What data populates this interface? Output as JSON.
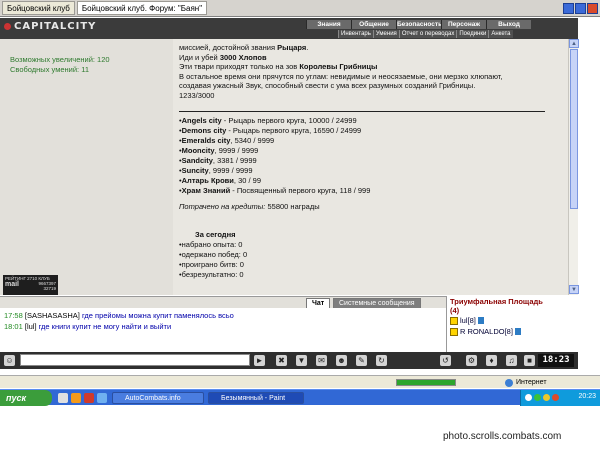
{
  "browser": {
    "tabs": [
      "Бойцовский клуб",
      "Бойцовский клуб. Форум: \"Баян\""
    ]
  },
  "header": {
    "logo": "CAPITALCITY",
    "nav_top": [
      "Знания",
      "Общение",
      "Безопасность",
      "Персонаж",
      "Выход"
    ],
    "nav_sub": [
      "Инвентарь",
      "Умения",
      "Отчет о переводах",
      "Поединки",
      "Анкета"
    ]
  },
  "left_panel": {
    "increases": "Возможных увеличений: 120",
    "skills": "Свободных умений: 11",
    "rating_label": "РЕЙТИНГ 2710 КЛУБ",
    "rating_values": [
      "9667397",
      "32719"
    ],
    "rating_brand": "mail"
  },
  "main": {
    "intro": [
      "миссией, достойной звания ",
      "Рыцаря",
      "Иди и убей ",
      "3000 Хлопов",
      "Эти твари приходят только на зов ",
      "Королевы Грибницы",
      "В остальное время они прячутся по углам: невидимые и неосязаемые, они мерзко хлюпают,",
      "создавая ужасный Звук, способный свести с ума всех разумных созданий Грибницы.",
      "1233/3000"
    ],
    "cities": [
      {
        "name": "Angels city",
        "desc": " - Рыцарь первого круга, 10000 / 24999"
      },
      {
        "name": "Demons city",
        "desc": " - Рыцарь первого круга, 16590 / 24999"
      },
      {
        "name": "Emeralds city",
        "desc": ", 5340 / 9999"
      },
      {
        "name": "Mooncity",
        "desc": ", 9999 / 9999"
      },
      {
        "name": "Sandcity",
        "desc": ", 3381 / 9999"
      },
      {
        "name": "Suncity",
        "desc": ", 9999 / 9999"
      },
      {
        "name": "Алтарь Крови",
        "desc": ", 30 / 99"
      },
      {
        "name": "Храм Знаний",
        "desc": " - Посвященный первого круга, 118 / 999"
      }
    ],
    "credits": "Потрачено на кредиты: ",
    "credits_value": "55800 награды",
    "today_title": "За сегодня",
    "today": [
      "набрано опыта: 0",
      "одержано побед: 0",
      "проиграно битв: 0",
      "безрезультатно: 0"
    ]
  },
  "chat": {
    "tab_chat": "Чат",
    "tab_system": "Системные сообщения",
    "lines": [
      {
        "time": "17:58",
        "nick": "[SASHASASHA]",
        "msg": " где прейомы можна купит паменялось всьо"
      },
      {
        "time": "18:01",
        "nick": "[lul]",
        "msg": " где книги купит не могу найти и выйти"
      }
    ]
  },
  "online": {
    "location": "Триумфальная Площадь",
    "count": "(4)",
    "players": [
      "lul[8]",
      "R RONALDO[8]"
    ]
  },
  "toolbar": {
    "clock": "18:23"
  },
  "statusbar": {
    "zone": "Интернет"
  },
  "taskbar": {
    "start": "пуск",
    "tasks": [
      "AutoCombats.info",
      "Безымянный - Paint"
    ],
    "time": "20:23"
  },
  "watermark": "photo.scrolls.combats.com"
}
